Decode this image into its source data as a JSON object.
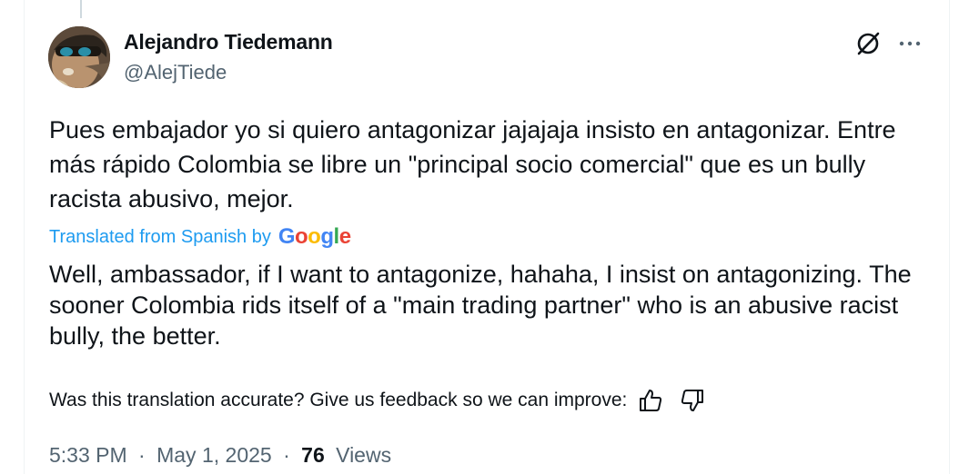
{
  "tweet": {
    "author": {
      "name": "Alejandro Tiedemann",
      "handle": "@AlejTiede"
    },
    "text": "Pues embajador yo si quiero antagonizar jajajaja insisto en antagonizar. Entre más rápido Colombia se libre un \"principal socio comercial\" que es un bully racista abusivo, mejor.",
    "translation": {
      "label": "Translated from Spanish by",
      "provider": {
        "letters": [
          "G",
          "o",
          "o",
          "g",
          "l",
          "e"
        ],
        "colors": [
          "#4285F4",
          "#EA4335",
          "#FBBC05",
          "#4285F4",
          "#34A853",
          "#EA4335"
        ]
      },
      "text": "Well, ambassador, if I want to antagonize, hahaha, I insist on antagonizing. The sooner Colombia rids itself of a \"main trading partner\" who is an abusive racist bully, the better.",
      "feedback_prompt": "Was this translation accurate? Give us feedback so we can improve:"
    },
    "meta": {
      "time": "5:33 PM",
      "separator": "·",
      "date": "May 1, 2025",
      "views_count": "76",
      "views_label": "Views"
    }
  },
  "icons": {
    "grok": "grok-icon",
    "more": "more-horizontal-icon",
    "thumbs_up": "thumbs-up-icon",
    "thumbs_down": "thumbs-down-icon"
  },
  "colors": {
    "text_primary": "#0f1419",
    "text_secondary": "#536471",
    "link_blue": "#1d9bf0",
    "border": "#eff3f4"
  }
}
